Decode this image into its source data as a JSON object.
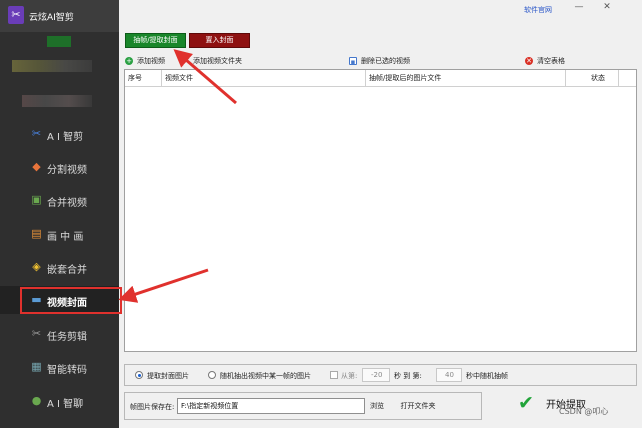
{
  "app": {
    "title": "云炫AI智剪",
    "logo_glyph": "✂"
  },
  "window": {
    "site_link": "软件官网",
    "minimize_glyph": "—",
    "close_glyph": "✕"
  },
  "sidebar": {
    "items": [
      {
        "label": "A I 智剪",
        "icon": "ai-scissors-icon",
        "glyph": "✂",
        "color": "#4a86e8"
      },
      {
        "label": "分割视频",
        "icon": "split-video-icon",
        "glyph": "◆",
        "color": "#e8743b"
      },
      {
        "label": "合并视频",
        "icon": "merge-video-icon",
        "glyph": "▣",
        "color": "#6aa84f"
      },
      {
        "label": "画 中 画",
        "icon": "picture-in-picture-icon",
        "glyph": "▤",
        "color": "#e69138"
      },
      {
        "label": "嵌套合并",
        "icon": "nested-merge-icon",
        "glyph": "◈",
        "color": "#f1c232"
      },
      {
        "label": "视频封面",
        "icon": "video-cover-icon",
        "glyph": "▬",
        "color": "#5b9bd5",
        "active": true
      },
      {
        "label": "任务剪辑",
        "icon": "task-edit-icon",
        "glyph": "✂",
        "color": "#9e9e9e"
      },
      {
        "label": "智能转码",
        "icon": "smart-transcode-icon",
        "glyph": "▦",
        "color": "#76a5af"
      },
      {
        "label": "A I 智聊",
        "icon": "ai-chat-icon",
        "glyph": "●",
        "color": "#6aa84f"
      }
    ]
  },
  "actions": {
    "extract_label": "抽帧/提取封面",
    "import_label": "置入封面"
  },
  "toolbar": {
    "add_video": "添加视频",
    "add_folder": "添加视频文件夹",
    "delete_selected": "删除已选的视频",
    "clear_table": "清空表格"
  },
  "table": {
    "columns": [
      "序号",
      "视频文件",
      "抽帧/提取后的图片文件",
      "状态"
    ],
    "rows": []
  },
  "options": {
    "extract_cover": "提取封面图片",
    "random_frame": "随机抽出视频中某一帧的图片",
    "from_label": "从第:",
    "from_value": "-20",
    "sec_to": "秒 到 第:",
    "to_value": "40",
    "sec_random": "秒中随机抽帧"
  },
  "save": {
    "label": "帧图片保存在:",
    "path": "F:\\指定新视频位置",
    "browse": "浏览",
    "open_folder": "打开文件夹"
  },
  "start": {
    "label": "开始提取"
  },
  "watermark": "CSDN @叩心"
}
